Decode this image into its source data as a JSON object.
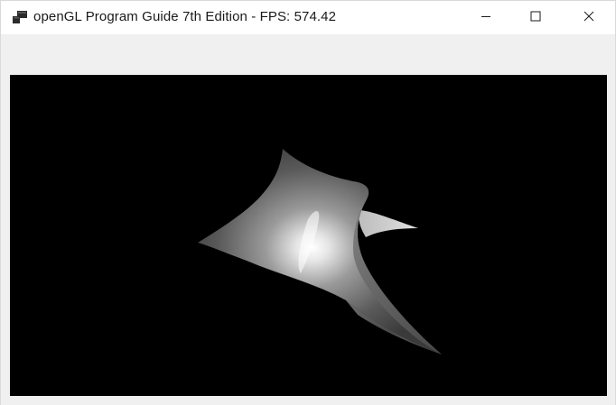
{
  "window": {
    "title": "openGL Program Guide 7th Edition - FPS: 574.42",
    "icon": "app-window-icon",
    "controls": {
      "minimize": "minimize-icon",
      "maximize": "maximize-icon",
      "close": "close-icon"
    }
  },
  "scene": {
    "background": "#000000",
    "object": "shaded-bezier-surface"
  },
  "colors": {
    "titlebar": "#ffffff",
    "client_background": "#f0f0f0",
    "viewport_background": "#000000",
    "surface_highlight": "#ffffff",
    "surface_shadow": "#3a3a3a"
  }
}
